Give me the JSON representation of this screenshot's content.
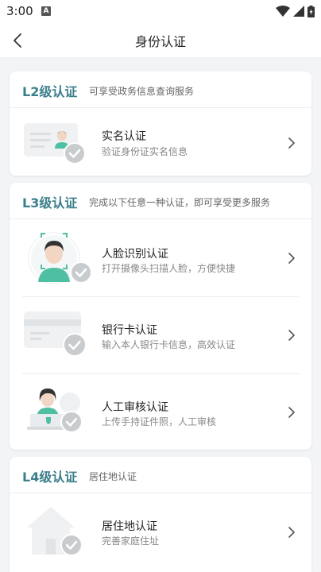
{
  "status": {
    "time": "3:00",
    "notification_glyph": "A"
  },
  "nav": {
    "title": "身份认证"
  },
  "l2": {
    "level": "L2级认证",
    "desc": "可享受政务信息查询服务",
    "items": [
      {
        "title": "实名认证",
        "subtitle": "验证身份证实名信息",
        "icon": "id-card-person-icon"
      }
    ]
  },
  "l3": {
    "level": "L3级认证",
    "desc": "完成以下任意一种认证，即可享受更多服务",
    "items": [
      {
        "title": "人脸识别认证",
        "subtitle": "打开摄像头扫描人脸，方便快捷",
        "icon": "face-scan-icon"
      },
      {
        "title": "银行卡认证",
        "subtitle": "输入本人银行卡信息，高效认证",
        "icon": "bank-card-icon"
      },
      {
        "title": "人工审核认证",
        "subtitle": "上传手持证件照，人工审核",
        "icon": "manual-review-icon"
      }
    ]
  },
  "l4": {
    "level": "L4级认证",
    "desc": "居住地认证",
    "items": [
      {
        "title": "居住地认证",
        "subtitle": "完善家庭住址",
        "icon": "house-icon"
      }
    ]
  },
  "colors": {
    "accent": "#3b7f8b",
    "background": "#f2f4f6",
    "check_badge": "#c9cccf"
  }
}
